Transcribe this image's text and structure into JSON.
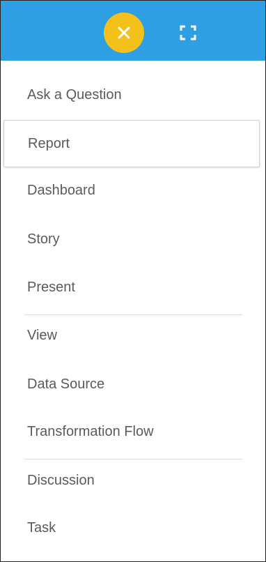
{
  "header": {
    "background_color": "#2f9fe3",
    "close_button": {
      "icon": "close-icon",
      "color": "#f3c11a"
    },
    "expand_button": {
      "icon": "fullscreen-icon"
    }
  },
  "menu": {
    "items": [
      {
        "label": "Ask a Question",
        "selected": false
      },
      {
        "label": "Report",
        "selected": true
      },
      {
        "label": "Dashboard",
        "selected": false
      },
      {
        "label": "Story",
        "selected": false
      },
      {
        "label": "Present",
        "selected": false
      },
      {
        "label": "View",
        "selected": false
      },
      {
        "label": "Data Source",
        "selected": false
      },
      {
        "label": "Transformation Flow",
        "selected": false
      },
      {
        "label": "Discussion",
        "selected": false
      },
      {
        "label": "Task",
        "selected": false
      }
    ]
  }
}
